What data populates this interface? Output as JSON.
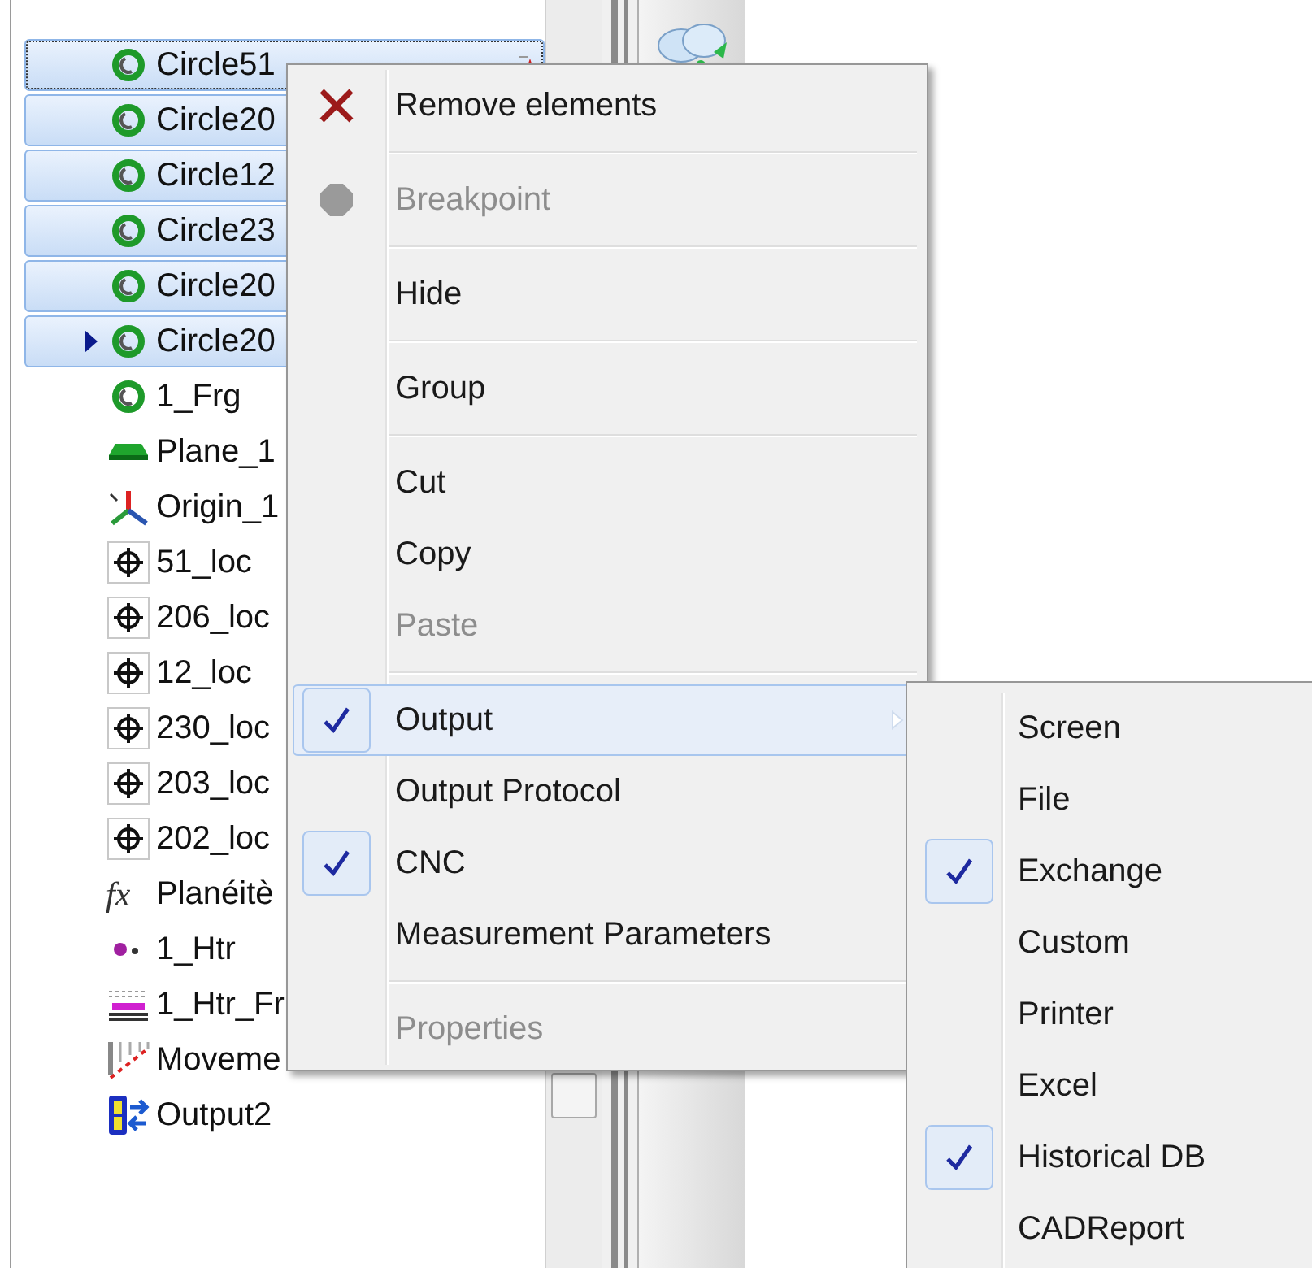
{
  "tree": {
    "items": [
      {
        "label": "Circle51",
        "kind": "circle",
        "selected": true,
        "focused": true,
        "current": false,
        "flag": true
      },
      {
        "label": "Circle20",
        "kind": "circle",
        "selected": true,
        "focused": false,
        "current": false
      },
      {
        "label": "Circle12",
        "kind": "circle",
        "selected": true,
        "focused": false,
        "current": false
      },
      {
        "label": "Circle23",
        "kind": "circle",
        "selected": true,
        "focused": false,
        "current": false
      },
      {
        "label": "Circle20",
        "kind": "circle",
        "selected": true,
        "focused": false,
        "current": false
      },
      {
        "label": "Circle20",
        "kind": "circle",
        "selected": true,
        "focused": false,
        "current": true
      },
      {
        "label": "1_Frg",
        "kind": "circle",
        "selected": false,
        "focused": false,
        "current": false
      },
      {
        "label": "Plane_1",
        "kind": "plane",
        "selected": false,
        "focused": false,
        "current": false
      },
      {
        "label": "Origin_1",
        "kind": "origin",
        "selected": false,
        "focused": false,
        "current": false
      },
      {
        "label": "51_loc",
        "kind": "locator",
        "selected": false,
        "focused": false,
        "current": false
      },
      {
        "label": "206_loc",
        "kind": "locator",
        "selected": false,
        "focused": false,
        "current": false
      },
      {
        "label": "12_loc",
        "kind": "locator",
        "selected": false,
        "focused": false,
        "current": false
      },
      {
        "label": "230_loc",
        "kind": "locator",
        "selected": false,
        "focused": false,
        "current": false
      },
      {
        "label": "203_loc",
        "kind": "locator",
        "selected": false,
        "focused": false,
        "current": false
      },
      {
        "label": "202_loc",
        "kind": "locator",
        "selected": false,
        "focused": false,
        "current": false
      },
      {
        "label": "Planéitè",
        "kind": "formula",
        "glyph": "fx",
        "selected": false,
        "focused": false,
        "current": false
      },
      {
        "label": "1_Htr",
        "kind": "point",
        "selected": false,
        "focused": false,
        "current": false
      },
      {
        "label": "1_Htr_Fr",
        "kind": "frame",
        "selected": false,
        "focused": false,
        "current": false
      },
      {
        "label": "Moveme",
        "kind": "movement",
        "selected": false,
        "focused": false,
        "current": false
      },
      {
        "label": "Output2",
        "kind": "output",
        "selected": false,
        "focused": false,
        "current": false
      }
    ]
  },
  "context_menu": {
    "items": [
      {
        "kind": "remove",
        "label": "Remove elements",
        "disabled": false,
        "selected": false
      },
      {
        "kind": "separator"
      },
      {
        "kind": "breakpoint",
        "label": "Breakpoint",
        "disabled": true,
        "selected": false
      },
      {
        "kind": "separator"
      },
      {
        "kind": "item",
        "label": "Hide",
        "disabled": false,
        "checked": false,
        "selected": false
      },
      {
        "kind": "separator"
      },
      {
        "kind": "item",
        "label": "Group",
        "disabled": false,
        "checked": false,
        "selected": false
      },
      {
        "kind": "separator"
      },
      {
        "kind": "item",
        "label": "Cut",
        "disabled": false,
        "checked": false,
        "selected": false
      },
      {
        "kind": "item",
        "label": "Copy",
        "disabled": false,
        "checked": false,
        "selected": false
      },
      {
        "kind": "item",
        "label": "Paste",
        "disabled": true,
        "checked": false,
        "selected": false
      },
      {
        "kind": "separator"
      },
      {
        "kind": "item",
        "label": "Output",
        "disabled": false,
        "checked": true,
        "selected": true,
        "submenu": true
      },
      {
        "kind": "item",
        "label": "Output Protocol",
        "disabled": false,
        "checked": false,
        "selected": false
      },
      {
        "kind": "item",
        "label": "CNC",
        "disabled": false,
        "checked": true,
        "selected": false
      },
      {
        "kind": "item",
        "label": "Measurement Parameters",
        "disabled": false,
        "checked": false,
        "selected": false
      },
      {
        "kind": "separator"
      },
      {
        "kind": "item",
        "label": "Properties",
        "disabled": true,
        "checked": false,
        "selected": false
      }
    ]
  },
  "submenu": {
    "items": [
      {
        "label": "Screen",
        "checked": false
      },
      {
        "label": "File",
        "checked": false
      },
      {
        "label": "Exchange",
        "checked": true
      },
      {
        "label": "Custom",
        "checked": false
      },
      {
        "label": "Printer",
        "checked": false
      },
      {
        "label": "Excel",
        "checked": false
      },
      {
        "label": "Historical DB",
        "checked": true
      },
      {
        "label": "CADReport",
        "checked": false
      }
    ]
  }
}
